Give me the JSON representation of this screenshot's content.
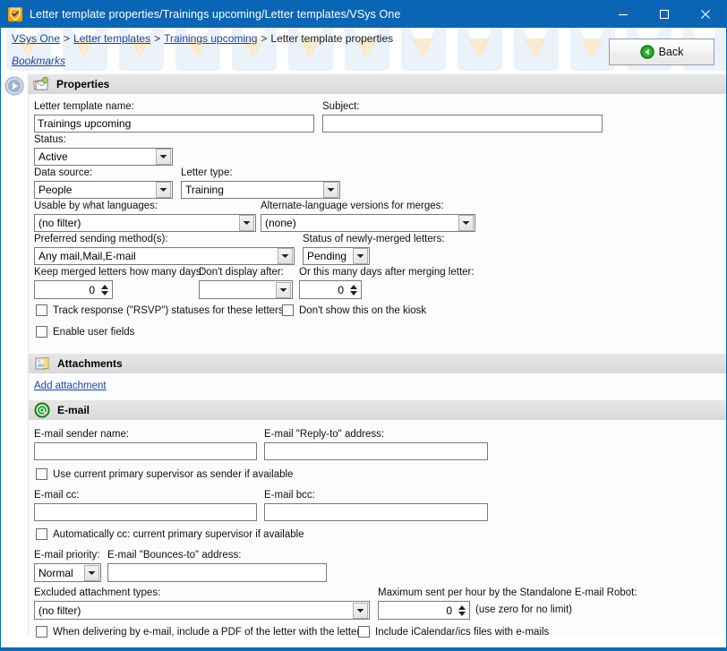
{
  "window": {
    "title": "Letter template properties/Trainings upcoming/Letter templates/VSys One",
    "app_icon": "vsys-shield-icon",
    "minimize_label": "–",
    "maximize_label": "□",
    "close_label": "✕",
    "accent_color": "#0a66b5"
  },
  "banner": {
    "breadcrumb": [
      {
        "label": "VSys One",
        "link": true
      },
      {
        "label": "Letter templates",
        "link": true
      },
      {
        "label": "Trainings upcoming",
        "link": true
      },
      {
        "label": "Letter template properties",
        "link": false
      }
    ],
    "separator": ">",
    "bookmarks_label": "Bookmarks",
    "back_button_label": "Back"
  },
  "sections": {
    "properties": {
      "title": "Properties",
      "icon": "letters-icon"
    },
    "attachments": {
      "title": "Attachments",
      "icon": "attachment-icon"
    },
    "email": {
      "title": "E-mail",
      "icon": "at-sign-icon"
    }
  },
  "properties": {
    "template_name_label": "Letter template name:",
    "template_name_value": "Trainings upcoming",
    "subject_label": "Subject:",
    "subject_value": "",
    "status_label": "Status:",
    "status_value": "Active",
    "data_source_label": "Data source:",
    "data_source_value": "People",
    "letter_type_label": "Letter type:",
    "letter_type_value": "Training",
    "languages_label": "Usable by what languages:",
    "languages_value": "(no filter)",
    "alt_language_label": "Alternate-language versions for merges:",
    "alt_language_value": "(none)",
    "sending_method_label": "Preferred sending method(s):",
    "sending_method_value": "Any mail,Mail,E-mail",
    "merged_status_label": "Status of newly-merged letters:",
    "merged_status_value": "Pending",
    "keep_days_label": "Keep merged letters how many days:",
    "keep_days_value": "0",
    "dont_display_after_label": "Don't display after:",
    "dont_display_after_value": "",
    "days_after_merge_label": "Or this many days after merging letter:",
    "days_after_merge_value": "0",
    "track_rsvp_label": "Track response (\"RSVP\") statuses for these letters",
    "kiosk_label": "Don't show this on the kiosk",
    "user_fields_label": "Enable user fields"
  },
  "attachments": {
    "add_link_label": "Add attachment"
  },
  "email": {
    "sender_name_label": "E-mail sender name:",
    "sender_name_value": "",
    "reply_to_label": "E-mail \"Reply-to\" address:",
    "reply_to_value": "",
    "use_supervisor_sender_label": "Use current primary supervisor as sender if available",
    "cc_label": "E-mail cc:",
    "cc_value": "",
    "bcc_label": "E-mail bcc:",
    "bcc_value": "",
    "auto_cc_supervisor_label": "Automatically cc: current primary supervisor if available",
    "priority_label": "E-mail priority:",
    "priority_value": "Normal",
    "bounces_to_label": "E-mail \"Bounces-to\" address:",
    "bounces_to_value": "",
    "excluded_types_label": "Excluded attachment types:",
    "excluded_types_value": "(no filter)",
    "max_per_hour_label": "Maximum sent per hour by the Standalone E-mail Robot:",
    "max_per_hour_value": "0",
    "max_per_hour_hint": "(use zero for no limit)",
    "include_pdf_label": "When delivering by e-mail, include a PDF of the letter with the letter",
    "include_ical_label": "Include iCalendar/ics files with e-mails"
  }
}
